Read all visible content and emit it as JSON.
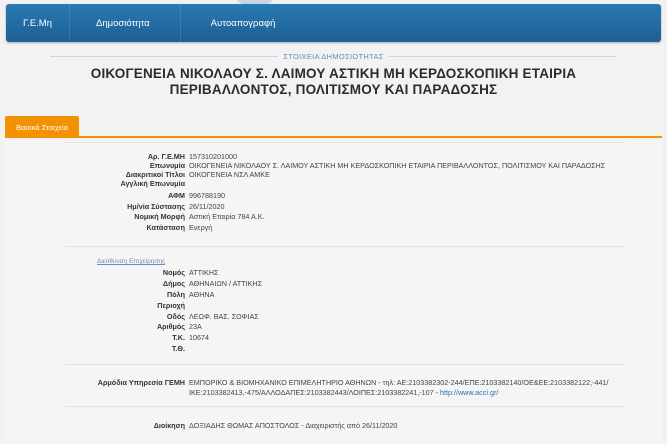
{
  "nav": {
    "items": [
      "Γ.Ε.Μη",
      "Δημοσιότητα",
      "Αυτοαπογραφή"
    ]
  },
  "section_label": "ΣΤΟΙΧΕΙΑ ΔΗΜΟΣΙΟΤΗΤΑΣ",
  "title_line1": "ΟΙΚΟΓΕΝΕΙΑ ΝΙΚΟΛΑΟΥ Σ. ΛΑΙΜΟΥ ΑΣΤΙΚΗ ΜΗ ΚΕΡΔΟΣΚΟΠΙΚΗ ΕΤΑΙΡΙΑ",
  "title_line2": "ΠΕΡΙΒΑΛΛΟΝΤΟΣ, ΠΟΛΙΤΙΣΜΟΥ ΚΑΙ ΠΑΡΑΔΟΣΗΣ",
  "tab_active": "Βασικά Στοιχεία",
  "basic": [
    {
      "label": "Αρ. Γ.Ε.ΜΗ",
      "value": "157310201000"
    },
    {
      "label": "Επωνυμία",
      "value": "ΟΙΚΟΓΕΝΕΙΑ ΝΙΚΟΛΑΟΥ Σ. ΛΑΙΜΟΥ ΑΣΤΙΚΗ ΜΗ ΚΕΡΔΟΣΚΟΠΙΚΗ ΕΤΑΙΡΙΑ ΠΕΡΙΒΑΛΛΟΝΤΟΣ, ΠΟΛΙΤΙΣΜΟΥ ΚΑΙ ΠΑΡΑΔΟΣΗΣ"
    },
    {
      "label": "Διακριτικοί Τίτλοι",
      "value": "ΟΙΚΟΓΕΝΕΙΑ ΝΣΛ ΑΜΚΕ"
    },
    {
      "label": "Αγγλική Επωνυμία",
      "value": ""
    },
    {
      "label": "ΑΦΜ",
      "value": "996788190"
    },
    {
      "label": "Ημ/νία Σύστασης",
      "value": "26/11/2020"
    },
    {
      "label": "Νομική Μορφή",
      "value": "Αστική Εταιρία 784 Α.Κ."
    },
    {
      "label": "Κατάσταση",
      "value": "Ενεργή"
    }
  ],
  "address_heading": "Διεύθυνση Επιχείρησης",
  "address": [
    {
      "label": "Νομός",
      "value": "ΑΤΤΙΚΗΣ"
    },
    {
      "label": "Δήμος",
      "value": "ΑΘΗΝΑΙΩΝ / ΑΤΤΙΚΗΣ"
    },
    {
      "label": "Πόλη",
      "value": "ΑΘΗΝΑ"
    },
    {
      "label": "Περιοχή",
      "value": ""
    },
    {
      "label": "Οδός",
      "value": "ΛΕΩΦ. ΒΑΣ. ΣΟΦΙΑΣ"
    },
    {
      "label": "Αριθμός",
      "value": "23Α"
    },
    {
      "label": "Τ.Κ.",
      "value": "10674"
    },
    {
      "label": "Τ.Θ.",
      "value": ""
    }
  ],
  "registry": {
    "label": "Αρμόδια Υπηρεσία ΓΕΜΗ",
    "line1": "ΕΜΠΟΡΙΚΟ & ΒΙΟΜΗΧΑΝΙΚΟ ΕΠΙΜΕΛΗΤΗΡΙΟ ΑΘΗΝΩΝ - τηλ: ΑΕ:2103382302-244/ΕΠΕ:2103382140/ΟΕ&ΕΕ:2103382122,-441/",
    "line2": "ΙΚΕ:2103382413,-475/ΑΛΛΟΔΑΠΕΣ:2103382443/ΛΟΙΠΕΣ:2103382241,-107 - ",
    "link": "http://www.acci.gr/"
  },
  "management": {
    "label": "Διοίκηση",
    "value": "ΔΟΞΙΑΔΗΣ ΘΩΜΑΣ ΑΠΟΣΤΟΛΟΣ - Διαχειριστής από 26/11/2020"
  }
}
